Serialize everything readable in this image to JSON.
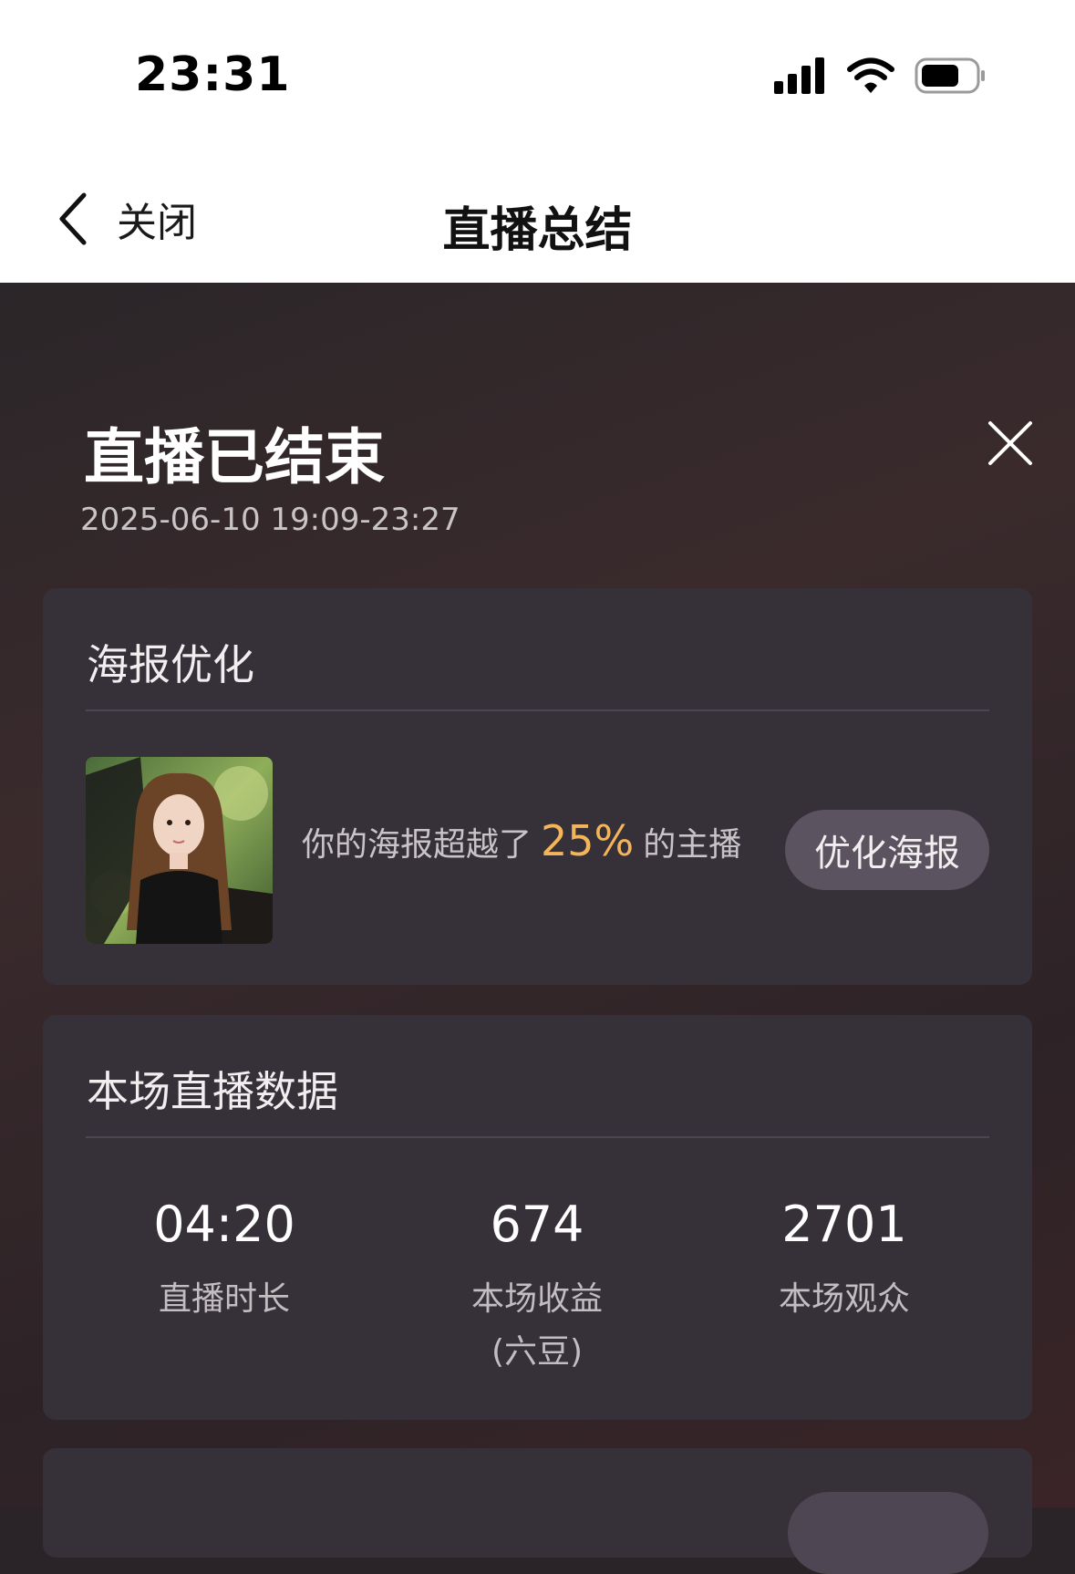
{
  "status_bar": {
    "time": "23:31"
  },
  "nav": {
    "back_label": "关闭",
    "title": "直播总结"
  },
  "summary": {
    "title": "直播已结束",
    "datetime": "2025-06-10 19:09-23:27"
  },
  "poster_card": {
    "title": "海报优化",
    "text_before": "你的海报超越了",
    "percent": "25%",
    "text_after": "的主播",
    "button_label": "优化海报"
  },
  "stats_card": {
    "title": "本场直播数据",
    "items": [
      {
        "value": "04:20",
        "label": "直播时长"
      },
      {
        "value": "674",
        "label": "本场收益\n(六豆)"
      },
      {
        "value": "2701",
        "label": "本场观众"
      }
    ]
  },
  "colors": {
    "accent": "#f3b55a",
    "card": "#363038",
    "button": "#5b5360"
  }
}
